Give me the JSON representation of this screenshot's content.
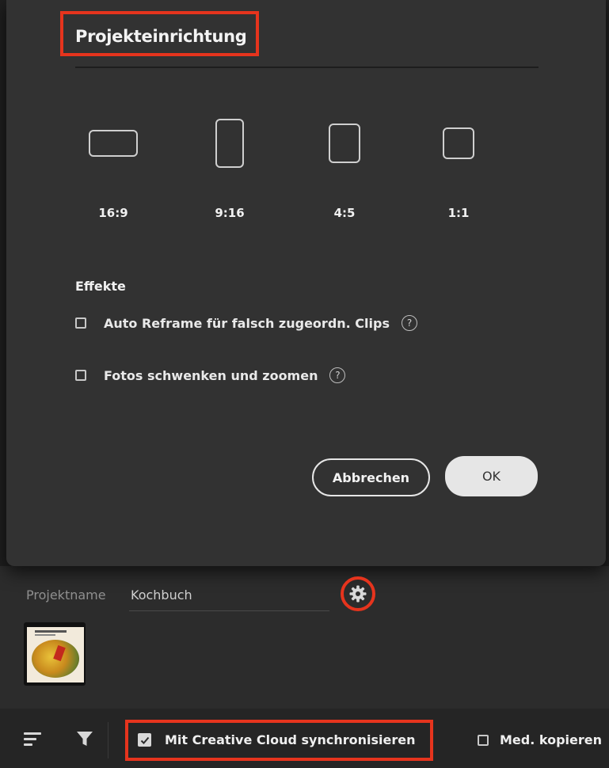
{
  "dialog": {
    "title": "Projekteinrichtung",
    "aspect_ratios": [
      {
        "label": "16:9"
      },
      {
        "label": "9:16"
      },
      {
        "label": "4:5"
      },
      {
        "label": "1:1"
      }
    ],
    "effects_heading": "Effekte",
    "effects": [
      {
        "label": "Auto Reframe für falsch zugeordn. Clips",
        "checked": false,
        "help": "?"
      },
      {
        "label": "Fotos schwenken und zoomen",
        "checked": false,
        "help": "?"
      }
    ],
    "cancel_label": "Abbrechen",
    "ok_label": "OK"
  },
  "project": {
    "name_label": "Projektname",
    "name_value": "Kochbuch",
    "settings_icon": "gear-icon"
  },
  "toolbar": {
    "menu_icon": "list-icon",
    "filter_icon": "filter-icon",
    "sync_label": "Mit Creative Cloud synchronisieren",
    "sync_checked": true,
    "copy_label": "Med. kopieren",
    "copy_checked": false
  },
  "colors": {
    "highlight": "#e6341d",
    "dialog_bg": "#323232",
    "app_bg": "#1f1f1f"
  }
}
